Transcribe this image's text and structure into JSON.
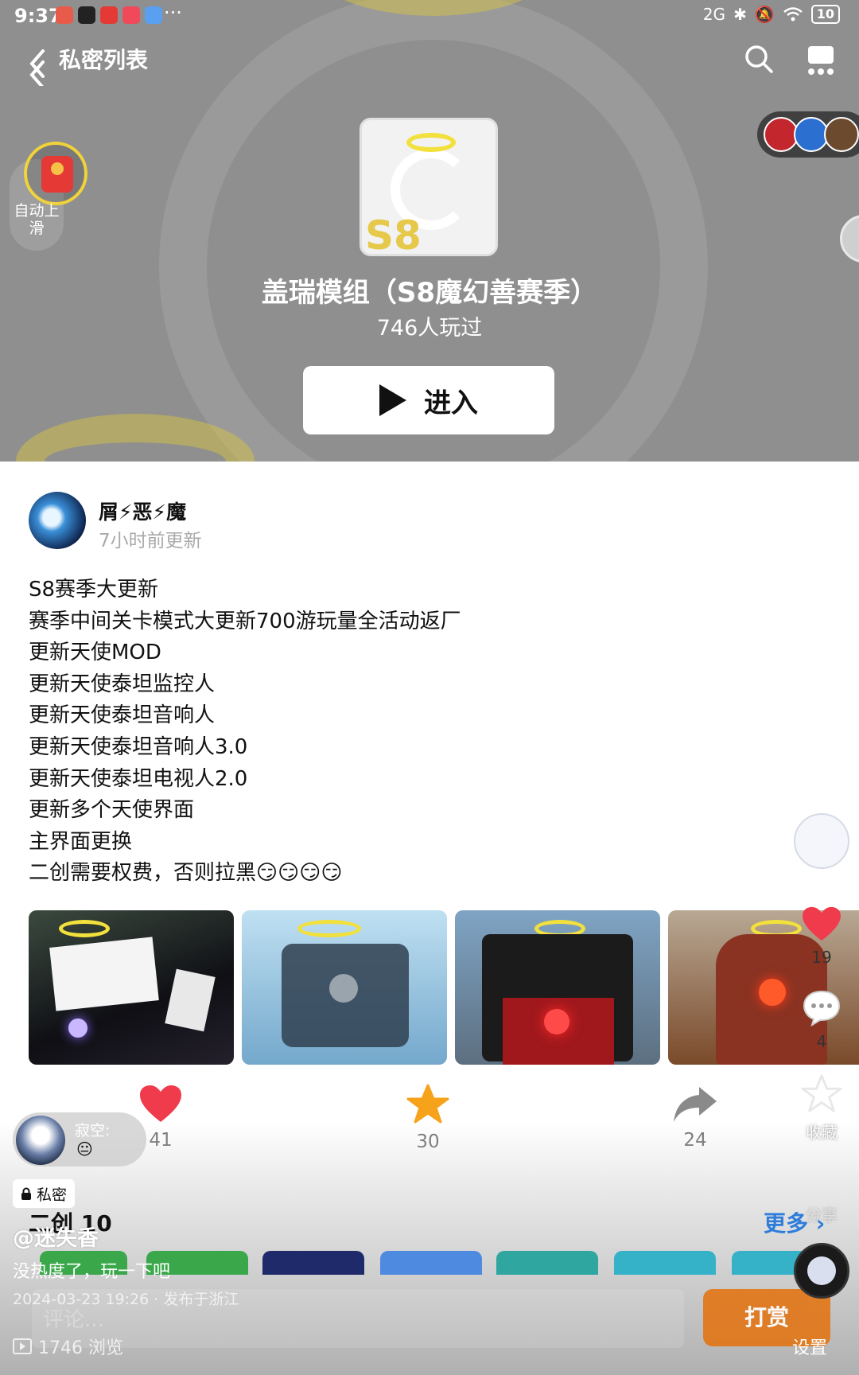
{
  "status_bar": {
    "time": "9:37",
    "overflow": "···",
    "network": "2G",
    "battery": "10"
  },
  "nav": {
    "title": "私密列表"
  },
  "auto_slide": {
    "label": "自动上滑"
  },
  "game": {
    "icon_text": "S8",
    "title": "盖瑞模组（S8魔幻善赛季）",
    "play_count": "746人玩过",
    "enter_label": "进入"
  },
  "post": {
    "author_name": "屑⚡恶⚡魔",
    "updated": "7小时前更新",
    "lines": [
      "S8赛季大更新",
      "赛季中间关卡模式大更新700游玩量全活动返厂",
      "更新天使MOD",
      "更新天使泰坦监控人",
      "更新天使泰坦音响人",
      "更新天使泰坦音响人3.0",
      "更新天使泰坦电视人2.0",
      "更新多个天使界面",
      "主界面更换",
      "二创需要权费，否则拉黑😏😏😏😏"
    ],
    "actions": {
      "likes": "41",
      "favorites": "30",
      "shares": "24"
    }
  },
  "derivatives": {
    "title": "二创 10",
    "more": "更多"
  },
  "rail": {
    "likes": "19",
    "comments": "4",
    "favorite_label": "收藏",
    "share_label": "分享",
    "settings_label": "设置"
  },
  "comment_bubble": {
    "name": "寂空:",
    "emoji": "😐"
  },
  "bottom": {
    "private_label": "私密",
    "uploader": "@迷失香",
    "caption": "没热度了，玩一下吧",
    "meta": "2024-03-23 19:26 · 发布于浙江",
    "views": "1746 浏览",
    "comment_placeholder": "评论...",
    "tip_label": "打赏"
  },
  "colors": {
    "like_red": "#ef3b4c",
    "star_orange": "#f7a21b",
    "share_gray": "#8a8a8a",
    "accent_blue": "#2f7ddb",
    "tip_orange": "#e2771a",
    "halo_yellow": "#f2e03c"
  }
}
